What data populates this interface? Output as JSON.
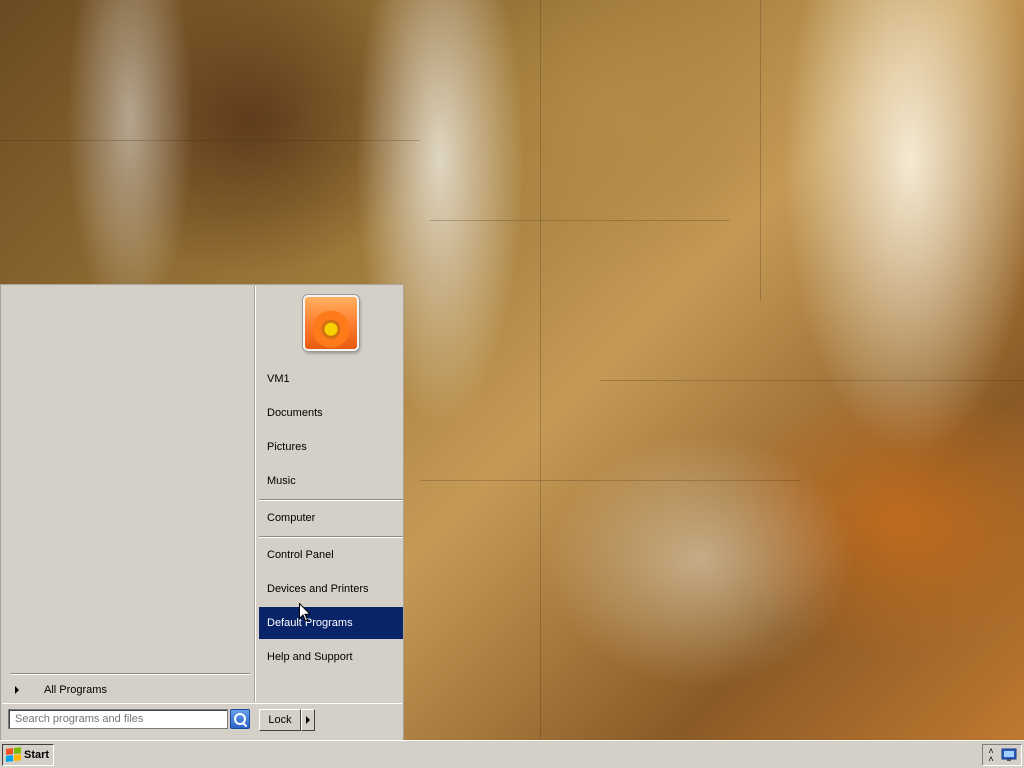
{
  "start_menu": {
    "all_programs_label": "All Programs",
    "search": {
      "placeholder": "Search programs and files"
    },
    "right_links": [
      {
        "label": "VM1"
      },
      {
        "label": "Documents"
      },
      {
        "label": "Pictures"
      },
      {
        "label": "Music"
      },
      {
        "label": "Computer"
      },
      {
        "label": "Control Panel"
      },
      {
        "label": "Devices and Printers"
      },
      {
        "label": "Default Programs",
        "selected": true
      },
      {
        "label": "Help and Support"
      }
    ],
    "lock_label": "Lock"
  },
  "taskbar": {
    "start_label": "Start",
    "tray_icons": [
      "chevron-up-icon",
      "network-icon"
    ]
  },
  "colors": {
    "menu_background": "#d4d0c8",
    "selection": "#0a246a",
    "selection_text": "#ffffff"
  }
}
